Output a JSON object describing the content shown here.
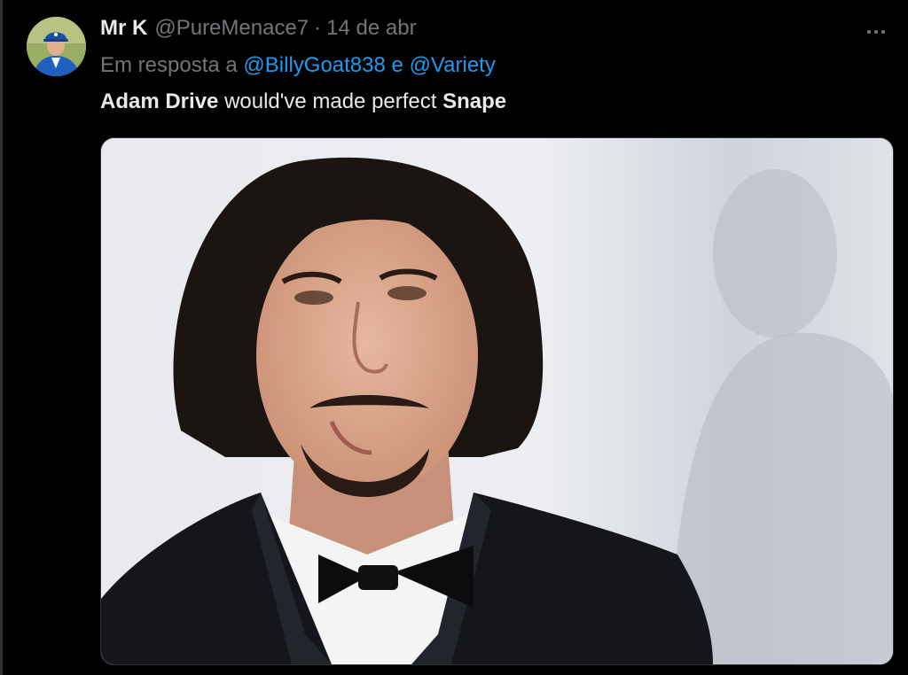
{
  "tweet": {
    "display_name": "Mr K",
    "handle": "@PureMenace7",
    "separator": "·",
    "timestamp": "14 de abr",
    "reply_prefix": "Em resposta a",
    "reply_mention_1": "@BillyGoat838",
    "reply_conjunction": "e",
    "reply_mention_2": "@Variety",
    "text_bold_1": "Adam Drive",
    "text_middle": "would've made perfect",
    "text_bold_2": "Snape"
  },
  "icons": {
    "more": "more-horizontal-icon"
  },
  "colors": {
    "background": "#000000",
    "primary_text": "#e7e9ea",
    "secondary_text": "#71767b",
    "link": "#1d9bf0"
  }
}
